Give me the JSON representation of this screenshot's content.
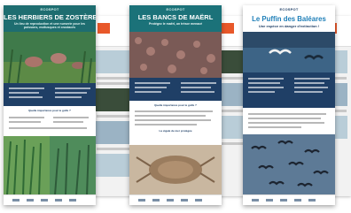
{
  "logo_text": "ECOSPOT",
  "posters": [
    {
      "title": "LES HERBIERS DE ZOSTÈRES",
      "subtitle": "Un lieu de reproduction et une nurserie pour les poissons, mollusques et crustacés",
      "question": "Quelle importance pour le golfe ?"
    },
    {
      "title": "LES BANCS DE MAËRL",
      "subtitle": "Protégez le maërl, un trésor menacé",
      "question": "Quelle importance pour le golfe ?",
      "caption": "La cigale de mer protégée"
    },
    {
      "title": "Le Puffin des Baléares",
      "subtitle": "Une espèce en danger d'extinction !"
    }
  ],
  "colors": {
    "seagrass_teal": "#1e6d70",
    "maerl_teal": "#1b7279",
    "navy_band": "#1f3f66",
    "puffin_blue": "#1f7fb8",
    "accent_orange": "#e8582a"
  }
}
